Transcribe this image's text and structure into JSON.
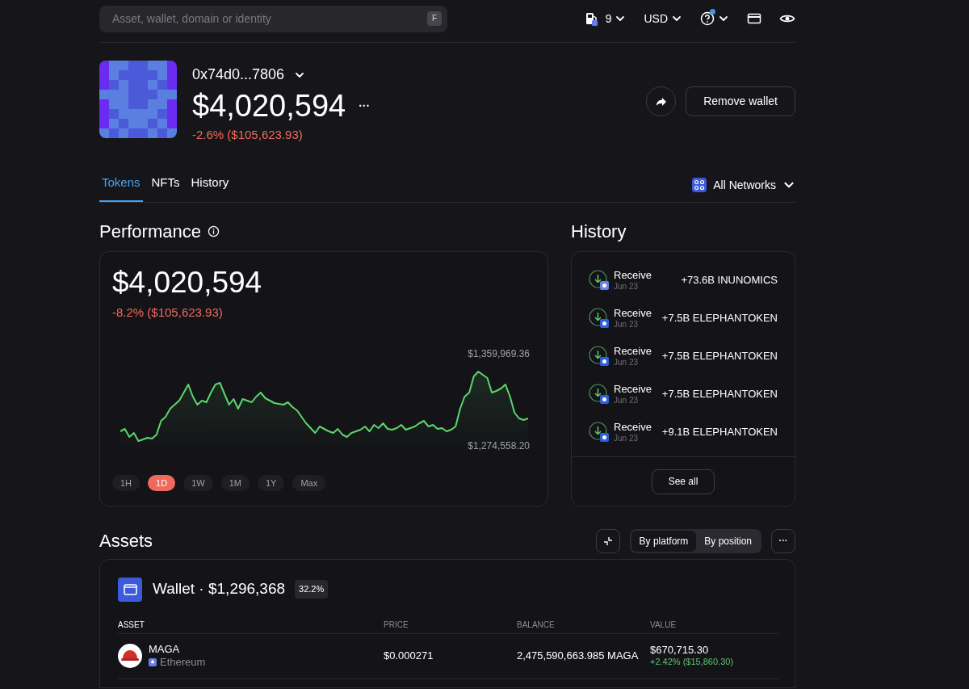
{
  "top_bar": {
    "search": {
      "placeholder": "Asset, wallet, domain or identity",
      "shortcut": "F"
    },
    "gas": "9",
    "currency": "USD",
    "help_notification": true
  },
  "wallet": {
    "address": "0x74d0...7806",
    "value": "$4,020,594",
    "change": "-2.6% ($105,623.93)",
    "negative": true,
    "more": "···",
    "remove_button": "Remove wallet"
  },
  "tabs": [
    {
      "label": "Tokens",
      "selected": true
    },
    {
      "label": "NFTs",
      "selected": false
    },
    {
      "label": "History",
      "selected": false
    }
  ],
  "network_filter": "All Networks",
  "performance": {
    "title": "Performance",
    "value": "$4,020,594",
    "change": "-8.2% ($105,623.93)",
    "negative": true,
    "max_label": "$1,359,969.36",
    "min_label": "$1,274,558.20",
    "ranges": [
      {
        "label": "1H",
        "selected": false
      },
      {
        "label": "1D",
        "selected": true
      },
      {
        "label": "1W",
        "selected": false
      },
      {
        "label": "1M",
        "selected": false
      },
      {
        "label": "1Y",
        "selected": false
      },
      {
        "label": "Max",
        "selected": false
      }
    ]
  },
  "history": {
    "title": "History",
    "items": [
      {
        "action": "Receive",
        "date": "Jun 23",
        "amount": "+73.6B INUNOMICS",
        "color": "#6b7fe8"
      },
      {
        "action": "Receive",
        "date": "Jun 23",
        "amount": "+7.5B ELEPHANTOKEN",
        "color": "#2f5fe0"
      },
      {
        "action": "Receive",
        "date": "Jun 23",
        "amount": "+7.5B ELEPHANTOKEN",
        "color": "#2f5fe0"
      },
      {
        "action": "Receive",
        "date": "Jun 23",
        "amount": "+7.5B ELEPHANTOKEN",
        "color": "#2f5fe0"
      },
      {
        "action": "Receive",
        "date": "Jun 23",
        "amount": "+9.1B ELEPHANTOKEN",
        "color": "#2f5fe0"
      }
    ],
    "see_all": "See all"
  },
  "assets": {
    "title": "Assets",
    "more": "···",
    "views": [
      {
        "label": "By platform",
        "selected": true
      },
      {
        "label": "By position",
        "selected": false
      }
    ],
    "group": {
      "title": "Wallet · $1,296,368",
      "share": "32.2%",
      "columns": [
        "ASSET",
        "PRICE",
        "BALANCE",
        "VALUE"
      ],
      "rows": [
        {
          "name": "MAGA",
          "network": "Ethereum",
          "price": "$0.000271",
          "balance": "2,475,590,663.985 MAGA",
          "value": "$670,715.30",
          "change": "+2.42% ($15,860.30)",
          "negative": false
        }
      ]
    }
  }
}
